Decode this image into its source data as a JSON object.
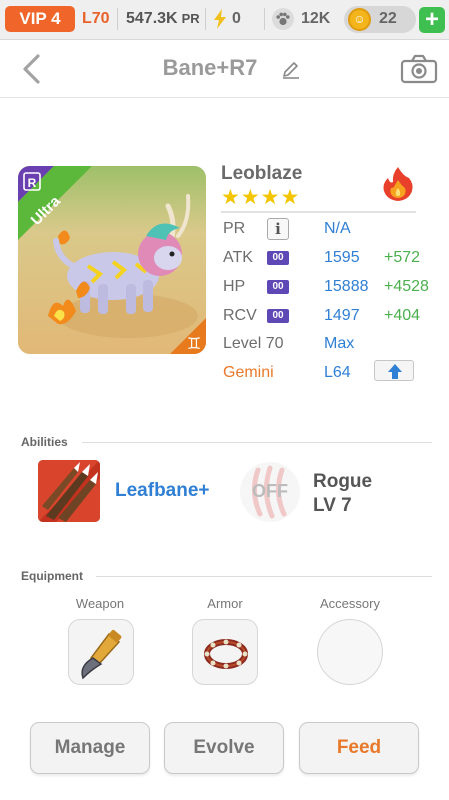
{
  "status_bar": {
    "vip": "VIP 4",
    "level": "L70",
    "power": "547.3K",
    "power_unit": "PR",
    "energy": "0",
    "paw_count": "12K",
    "coins": "22",
    "add": "+"
  },
  "header": {
    "title": "Bane+R7"
  },
  "creature": {
    "name": "Leoblaze",
    "stars": "★★★★",
    "rarity": "Ultra",
    "rarity_badge": "R",
    "element": "fire",
    "stats": {
      "pr_label": "PR",
      "pr_info": "i",
      "pr_value": "N/A",
      "atk_label": "ATK",
      "atk_chip": "00",
      "atk_value": "1595",
      "atk_bonus": "+572",
      "hp_label": "HP",
      "hp_chip": "00",
      "hp_value": "15888",
      "hp_bonus": "+4528",
      "rcv_label": "RCV",
      "rcv_chip": "00",
      "rcv_value": "1497",
      "rcv_bonus": "+404",
      "level_label": "Level 70",
      "level_value": "Max",
      "sign_label": "Gemini",
      "sign_value": "L64"
    }
  },
  "abilities": {
    "section_title": "Abilities",
    "ability_name": "Leafbane+",
    "slot_state": "OFF",
    "class_name": "Rogue",
    "class_level": "LV 7"
  },
  "equipment": {
    "section_title": "Equipment",
    "weapon_label": "Weapon",
    "armor_label": "Armor",
    "accessory_label": "Accessory"
  },
  "actions": {
    "manage": "Manage",
    "evolve": "Evolve",
    "feed": "Feed"
  },
  "colors": {
    "vip_orange": "#f0662a",
    "stat_blue": "#2f7fd4",
    "bonus_green": "#4cb04e",
    "gemini_orange": "#e8792a",
    "star_yellow": "#f2c500",
    "ultra_green": "#5cb83a",
    "badge_purple": "#6a3fb0"
  }
}
